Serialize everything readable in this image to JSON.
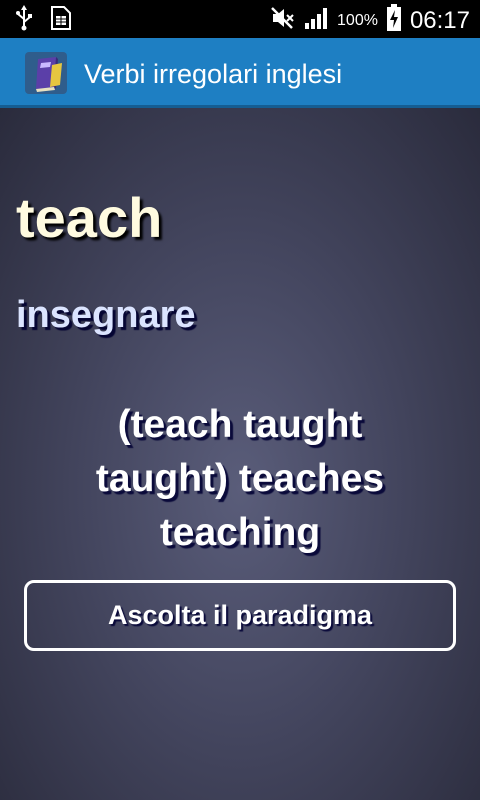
{
  "status_bar": {
    "icons_left": [
      "usb-icon",
      "sim-card-icon"
    ],
    "icons_right": [
      "mute-icon",
      "signal-icon"
    ],
    "battery_text": "100%",
    "time": "06:17"
  },
  "action_bar": {
    "app_icon": "book-icon",
    "title": "Verbi irregolari inglesi",
    "color": "#1e7fc3"
  },
  "main": {
    "word": "teach",
    "translation": "insegnare",
    "paradigm": "(teach taught taught)   teaches teaching",
    "listen_button": "Ascolta il paradigma"
  }
}
